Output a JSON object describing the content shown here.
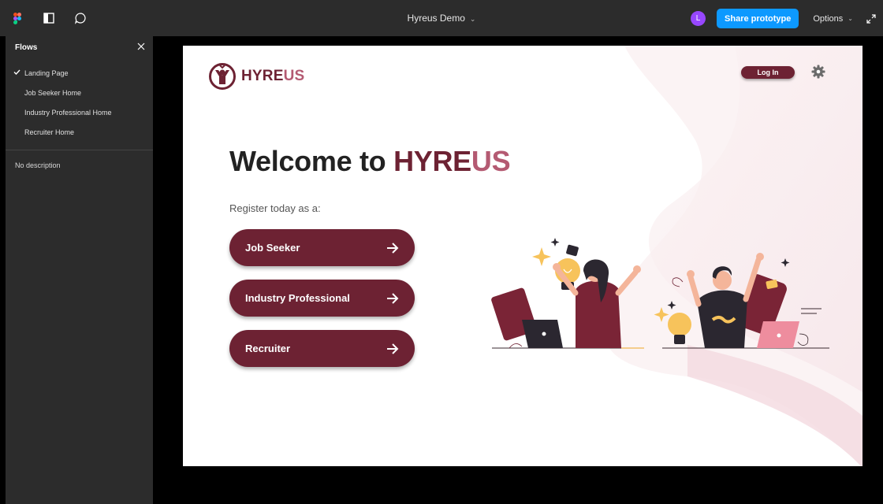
{
  "toolbar": {
    "file_title": "Hyreus Demo",
    "avatar_initial": "L",
    "share_label": "Share prototype",
    "options_label": "Options"
  },
  "sidebar": {
    "title": "Flows",
    "items": [
      {
        "label": "Landing Page",
        "selected": true
      },
      {
        "label": "Job Seeker Home",
        "selected": false
      },
      {
        "label": "Industry Professional Home",
        "selected": false
      },
      {
        "label": "Recruiter Home",
        "selected": false
      }
    ],
    "description": "No description"
  },
  "page": {
    "brand_part1": "HYRE",
    "brand_part2": "US",
    "login_label": "Log In",
    "welcome_prefix": "Welcome to ",
    "welcome_brand1": "HYRE",
    "welcome_brand2": "US",
    "register_text": "Register today as a:",
    "roles": [
      {
        "label": "Job Seeker"
      },
      {
        "label": "Industry Professional"
      },
      {
        "label": "Recruiter"
      }
    ]
  },
  "colors": {
    "toolbar_bg": "#2c2c2c",
    "share_blue": "#0d99ff",
    "avatar_purple": "#9747ff",
    "brand_maroon": "#6d2233",
    "brand_pink": "#b45a72"
  },
  "icons": {
    "figma_logo": "figma-logo-icon",
    "layout": "panel-layout-icon",
    "comment": "comment-icon",
    "expand": "expand-icon",
    "close": "close-icon",
    "check": "check-icon",
    "gear": "gear-icon",
    "arrow": "arrow-right-icon"
  }
}
